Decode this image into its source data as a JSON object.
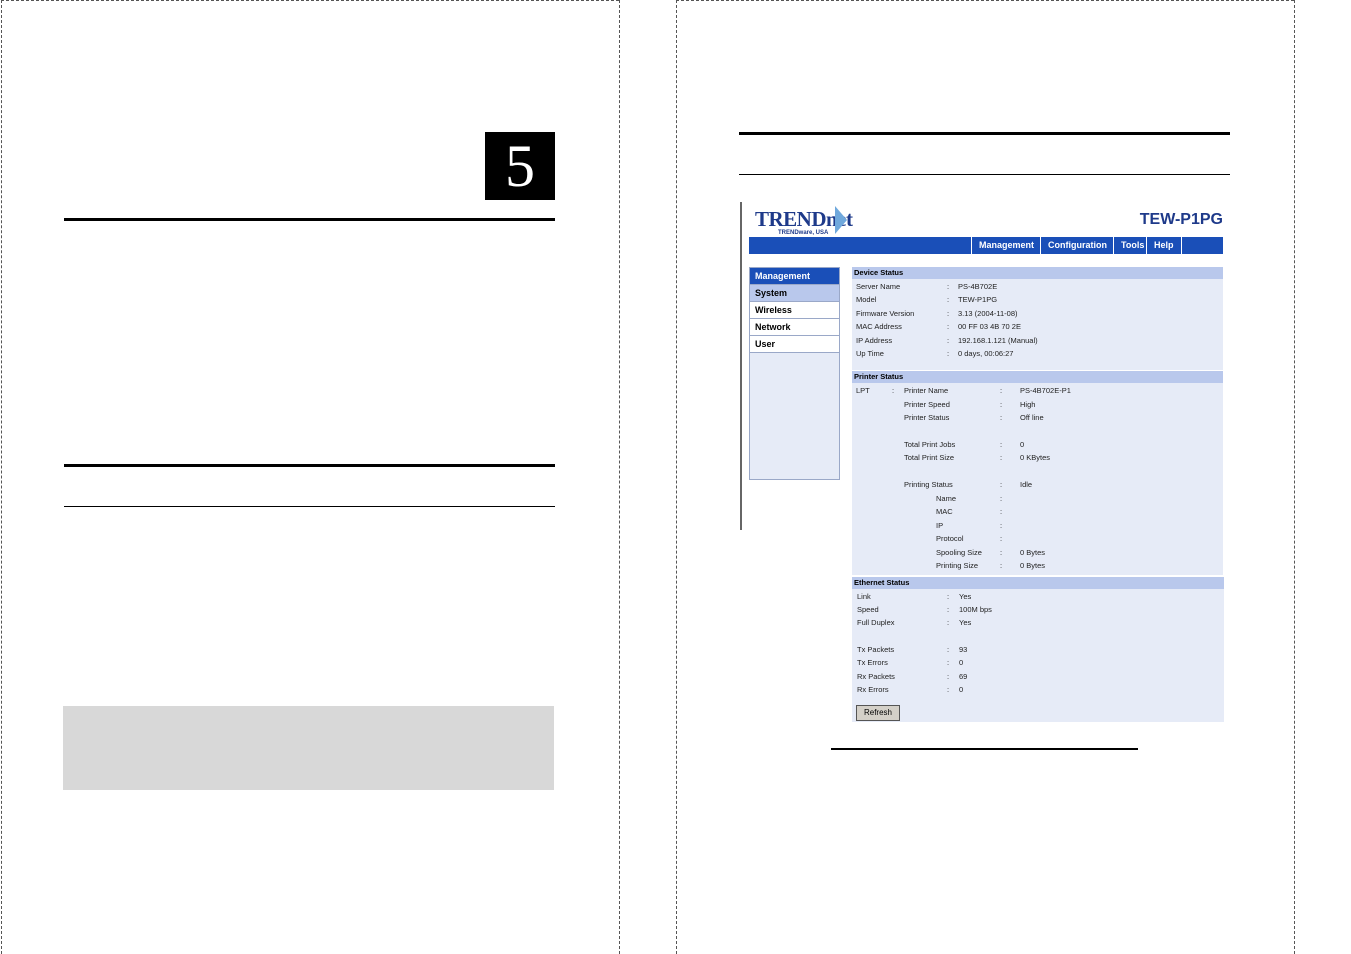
{
  "left_page": {
    "chapter_number": "5"
  },
  "screenshot": {
    "logo": "TRENDnet",
    "logo_sub": "TRENDware, USA",
    "model": "TEW-P1PG",
    "nav": [
      "Management",
      "Configuration",
      "Tools",
      "Help"
    ],
    "sidebar": [
      "Management",
      "System",
      "Wireless",
      "Network",
      "User"
    ],
    "device_status": {
      "title": "Device Status",
      "rows": [
        {
          "label": "Server Name",
          "value": "PS-4B702E"
        },
        {
          "label": "Model",
          "value": "TEW-P1PG"
        },
        {
          "label": "Firmware Version",
          "value": "3.13 (2004-11-08)"
        },
        {
          "label": "MAC Address",
          "value": "00 FF 03 4B 70 2E"
        },
        {
          "label": "IP Address",
          "value": "192.168.1.121 (Manual)"
        },
        {
          "label": "Up Time",
          "value": "0 days, 00:06:27"
        }
      ]
    },
    "printer_status": {
      "title": "Printer Status",
      "port": "LPT",
      "rows": [
        {
          "label": "Printer Name",
          "value": "PS-4B702E-P1"
        },
        {
          "label": "Printer Speed",
          "value": "High"
        },
        {
          "label": "Printer Status",
          "value": "Off line"
        },
        {
          "label": "Total Print Jobs",
          "value": "0"
        },
        {
          "label": "Total Print Size",
          "value": "0 KBytes"
        },
        {
          "label": "Printing Status",
          "value": "Idle"
        }
      ],
      "sub_rows": [
        {
          "label": "Name",
          "value": ""
        },
        {
          "label": "MAC",
          "value": ""
        },
        {
          "label": "IP",
          "value": ""
        },
        {
          "label": "Protocol",
          "value": ""
        },
        {
          "label": "Spooling Size",
          "value": "0 Bytes"
        },
        {
          "label": "Printing Size",
          "value": "0 Bytes"
        }
      ]
    },
    "ethernet_status": {
      "title": "Ethernet Status",
      "rows": [
        {
          "label": "Link",
          "value": "Yes"
        },
        {
          "label": "Speed",
          "value": "100M bps"
        },
        {
          "label": "Full Duplex",
          "value": "Yes"
        },
        {
          "label": "Tx Packets",
          "value": "93"
        },
        {
          "label": "Tx Errors",
          "value": "0"
        },
        {
          "label": "Rx Packets",
          "value": "69"
        },
        {
          "label": "Rx Errors",
          "value": "0"
        }
      ]
    },
    "refresh_label": "Refresh"
  }
}
